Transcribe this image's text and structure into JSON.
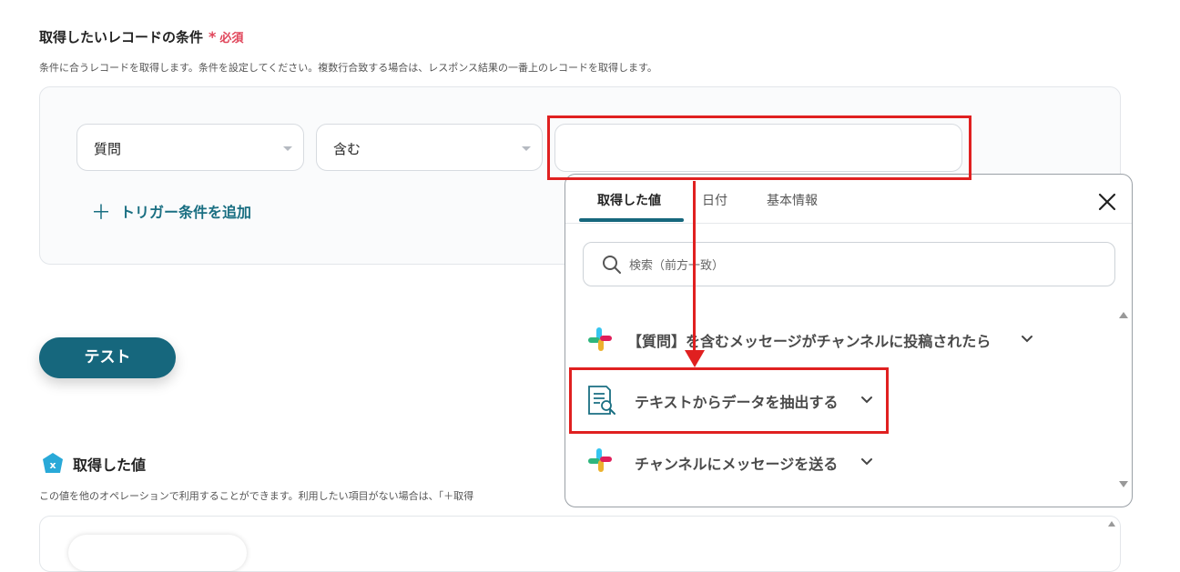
{
  "condition_section": {
    "title": "取得したいレコードの条件",
    "required_star": "*",
    "required_label": "必須",
    "description": "条件に合うレコードを取得します。条件を設定してください。複数行合致する場合は、レスポンス結果の一番上のレコードを取得します。",
    "field_select": "質問",
    "operator_select": "含む",
    "value_input": "",
    "add_trigger_label": "トリガー条件を追加"
  },
  "test_button_label": "テスト",
  "acquired_section": {
    "title": "取得した値",
    "description": "この値を他のオペレーションで利用することができます。利用したい項目がない場合は、「＋取得"
  },
  "popup": {
    "tabs": [
      "取得した値",
      "日付",
      "基本情報"
    ],
    "active_tab": "取得した値",
    "search_placeholder": "検索（前方一致）",
    "items": [
      {
        "icon": "slack-icon",
        "label": "【質問】を含むメッセージがチャンネルに投稿されたら"
      },
      {
        "icon": "document-search-icon",
        "label": "テキストからデータを抽出する"
      },
      {
        "icon": "slack-icon",
        "label": "チャンネルにメッセージを送る"
      }
    ]
  },
  "colors": {
    "accent": "#16677d",
    "required": "#e0455a",
    "annotation": "#e02020"
  }
}
